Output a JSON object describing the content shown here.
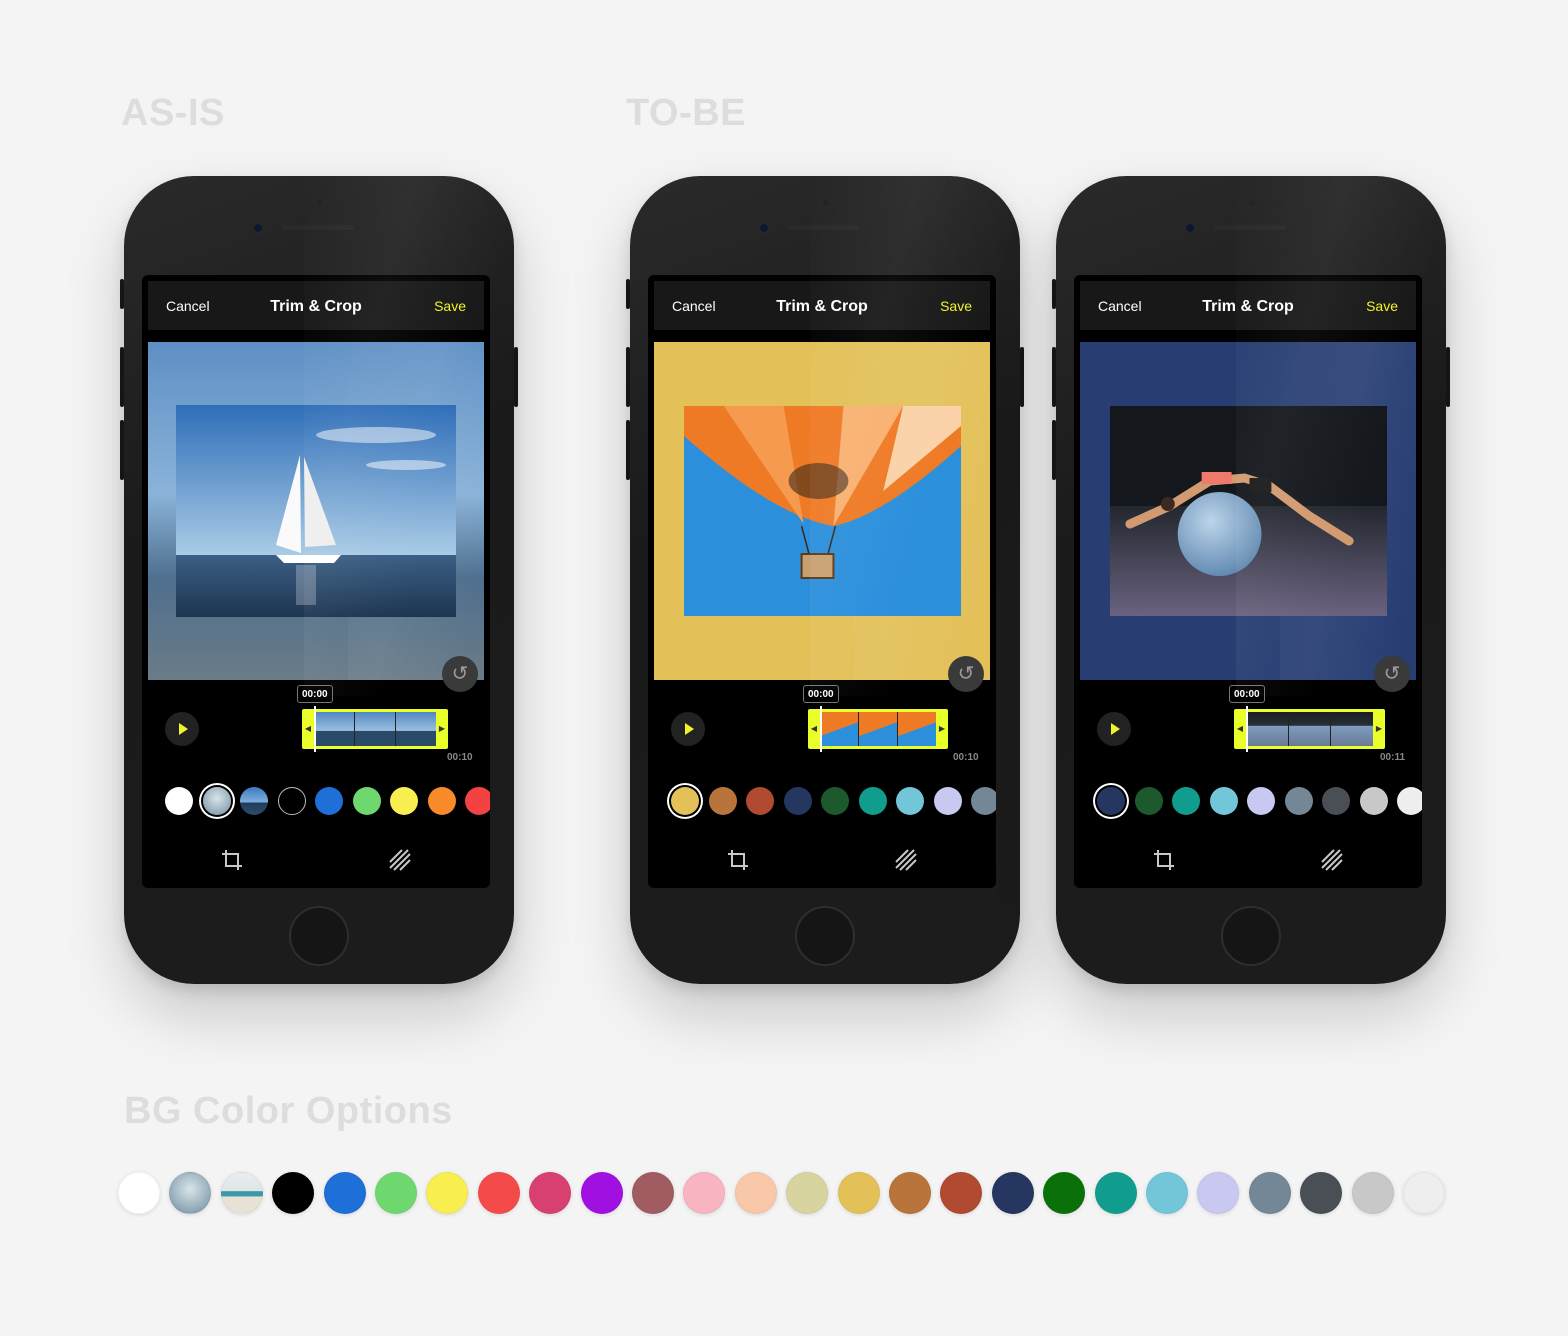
{
  "sections": {
    "as_is": "AS-IS",
    "to_be": "TO-BE",
    "bg_color_options": "BG Color Options"
  },
  "phones": [
    {
      "topbar": {
        "cancel": "Cancel",
        "title": "Trim & Crop",
        "save": "Save"
      },
      "canvas_bg": "#6ea0cf",
      "photo": "sailboat on the sea",
      "time_start": "00:00",
      "time_end": "00:10",
      "swatches": [
        "#ffffff",
        "image-blur",
        "image-sail",
        "#000000",
        "#1f6fd8",
        "#6ed86e",
        "#f8ee50",
        "#f88a2a",
        "#f44242"
      ],
      "selected_swatch": 1
    },
    {
      "topbar": {
        "cancel": "Cancel",
        "title": "Trim & Crop",
        "save": "Save"
      },
      "canvas_bg": "#e3c058",
      "photo": "hot air balloon against blue sky",
      "time_start": "00:00",
      "time_end": "00:10",
      "swatches": [
        "#e3c058",
        "#b8743a",
        "#b04a30",
        "#253660",
        "#1c5a2e",
        "#109d8e",
        "#72c6d8",
        "#c8c8f0",
        "#738796"
      ],
      "selected_swatch": 0
    },
    {
      "topbar": {
        "cancel": "Cancel",
        "title": "Trim & Crop",
        "save": "Save"
      },
      "canvas_bg": "#283e73",
      "photo": "woman stretching on exercise ball",
      "time_start": "00:00",
      "time_end": "00:11",
      "swatches": [
        "#253660",
        "#1c5a2e",
        "#109d8e",
        "#72c6d8",
        "#c8c8f0",
        "#738796",
        "#4a4f56",
        "#c8c8c8",
        "#eeeeee"
      ],
      "selected_swatch": 0
    }
  ],
  "bg_palette": [
    "#ffffff",
    "image-blur",
    "image-beach",
    "#000000",
    "#1f6fd8",
    "#6ed86e",
    "#f8ee50",
    "#f44a4a",
    "#d84070",
    "#a010e0",
    "#a05c60",
    "#f8b4c0",
    "#f8c8a8",
    "#d8d4a0",
    "#e3c058",
    "#b8743a",
    "#b04a30",
    "#253660",
    "#0a700a",
    "#109d8e",
    "#72c6d8",
    "#c8c8f0",
    "#738796",
    "#4a4f56",
    "#c8c8c8",
    "#eeeeee"
  ],
  "icons": {
    "crop": "crop-icon",
    "pattern": "hatch-pattern-icon",
    "undo": "undo-icon",
    "play": "play-icon"
  }
}
